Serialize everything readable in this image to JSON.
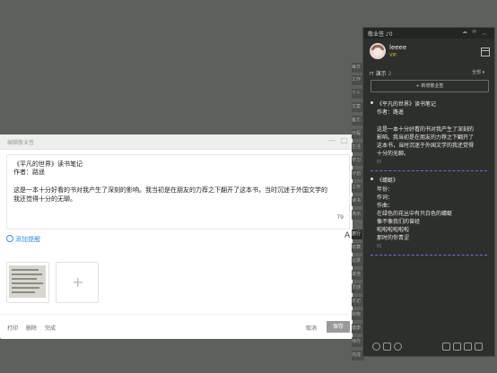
{
  "dialog": {
    "title": "编辑敬业签",
    "min_glyph": "—",
    "max_glyph": "□",
    "lines": [
      "《平凡的世界》读书笔记",
      "作者：路遥",
      "这是一本十分好看的书对我产生了深刻的影响。我当初是在朋友的力荐之下翻开了这本书，当时沉迷于外国文学的",
      "我还觉得十分的无聊。"
    ],
    "char_count": "79",
    "add_reminder": "添加提醒",
    "add_image_glyph": "+",
    "footer": {
      "print": "打印",
      "delete": "删除",
      "done": "完成",
      "cancel": "取消",
      "save": "保存"
    },
    "font_icon_glyph": "A"
  },
  "tags": [
    {
      "label": "每日"
    },
    {
      "label": "工作"
    },
    {
      "label": "个人"
    },
    {
      "label": "文案"
    },
    {
      "label": "备忘"
    },
    {
      "label": "日程"
    },
    {
      "label": "生活"
    },
    {
      "label": "学习"
    },
    {
      "label": "计划"
    },
    {
      "label": "工作"
    },
    {
      "label": "读书"
    },
    {
      "label": "演示"
    },
    {
      "label": "旅行"
    },
    {
      "label": "收藏"
    },
    {
      "label": "记录"
    },
    {
      "label": "其他"
    },
    {
      "label": "灵感"
    },
    {
      "label": "日记"
    },
    {
      "label": "购物"
    },
    {
      "label": "健康"
    },
    {
      "label": "待办"
    },
    {
      "label": "完成"
    },
    {
      "label": "+"
    }
  ],
  "panel": {
    "title": "敬业签",
    "notif_count": "0",
    "username": "leeee",
    "vip": "VIP",
    "category": "演示",
    "category_count": "2",
    "filter": "全部",
    "new_button": "+ 新增敬业签",
    "notes": [
      {
        "lines": [
          "《平凡的世界》读书笔记",
          "作者：路遥",
          "",
          "这是一本十分好看的书对我产生了深刻的",
          "影响。我当初是在朋友的力荐之下翻开了",
          "这本书，当时沉迷于外国文学的我还觉得",
          "十分的无聊。"
        ],
        "meta": "四"
      },
      {
        "lines": [
          "《蜻蜓》",
          "年份：",
          "作词：",
          "作曲：",
          "在绿色的花丛中有只白色的蜻蜓",
          "像不像我们的曾经",
          "啦啦啦啦啦啦",
          "那时的你青涩"
        ],
        "meta": "四"
      }
    ]
  },
  "colors": {
    "background": "#5d605c",
    "panel": "#2d2f2c",
    "accent": "#3a8ee6",
    "divider": "#6d6fd2",
    "vip": "#e8b83a"
  }
}
